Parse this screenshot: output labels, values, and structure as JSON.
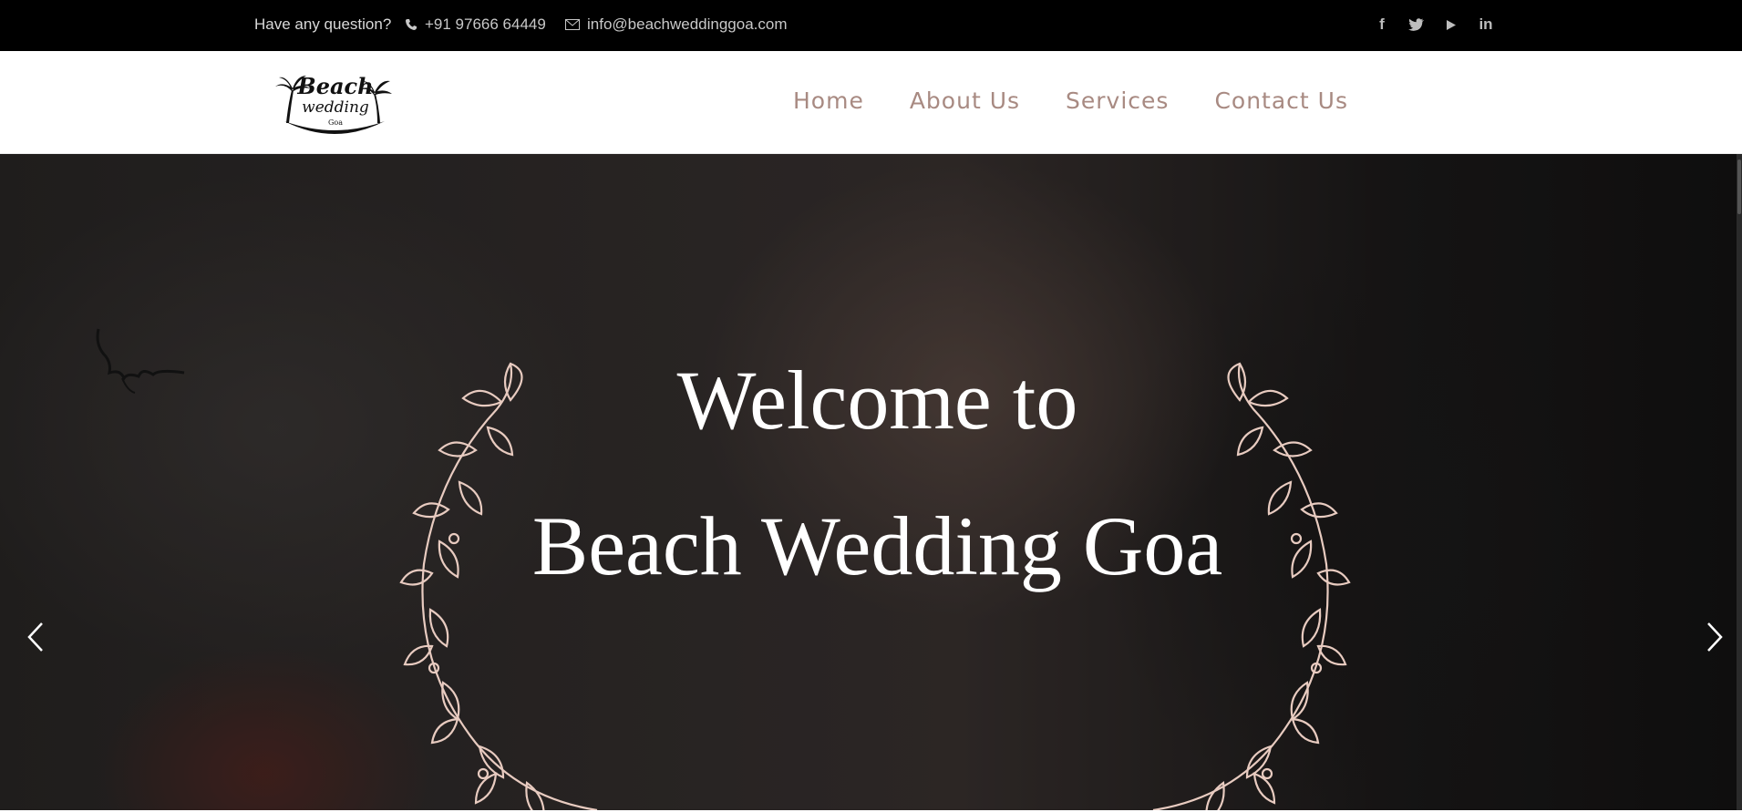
{
  "topbar": {
    "question": "Have any question?",
    "phone": "+91 97666 64449",
    "email": "info@beachweddinggoa.com",
    "social": [
      {
        "icon": "facebook-icon",
        "glyph": "f"
      },
      {
        "icon": "twitter-icon",
        "glyph": "🐦"
      },
      {
        "icon": "youtube-icon",
        "glyph": "▶"
      },
      {
        "icon": "linkedin-icon",
        "glyph": "in"
      }
    ]
  },
  "logo": {
    "line1": "Beach",
    "line2": "wedding",
    "line3": "Goa"
  },
  "nav": {
    "items": [
      "Home",
      "About Us",
      "Services",
      "Contact Us"
    ]
  },
  "hero": {
    "line1": "Welcome to",
    "line2": "Beach Wedding Goa",
    "prev_icon": "chevron-left-icon",
    "next_icon": "chevron-right-icon"
  },
  "colors": {
    "topbar_bg": "#000000",
    "nav_text": "#a88a82",
    "laurel": "#e8cbc0"
  }
}
